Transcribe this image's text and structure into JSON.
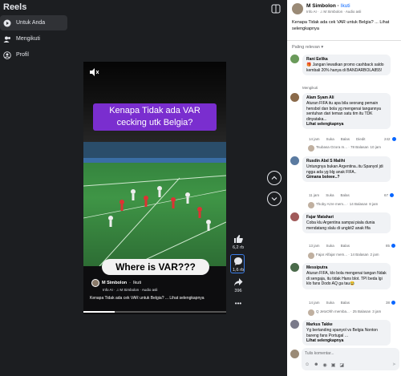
{
  "sidebar": {
    "title": "Reels",
    "items": [
      {
        "label": "Untuk Anda",
        "icon": "play-icon"
      },
      {
        "label": "Mengikuti",
        "icon": "people-icon"
      },
      {
        "label": "Profil",
        "icon": "profile-icon"
      }
    ]
  },
  "video": {
    "caption_top": "Kenapa Tidak ada VAR cecking utk Belgia?",
    "caption_bottom": "Where is VAR???",
    "author": "M Simbolon",
    "follow": "Ikuti",
    "info": "Info AI · ♫ M Simbolon · Audio asli",
    "description": "Kenapa Tidak ada cek VAR untuk Belgia? ... Lihat selengkapnya",
    "progress_fraction": 0.22
  },
  "actions": {
    "likes": "6,2 rb",
    "comments": "1,6 rb",
    "shares": "396",
    "more": "•••"
  },
  "post": {
    "author": "M Simbolon",
    "follow": "Ikuti",
    "sub": "Info AI · ♫ M Simbolon · Audio asli",
    "text": "Kenapa Tidak ada cek VAR untuk Belgia? ... Lihat selengkapnya"
  },
  "comments_sort": "Paling relevan ▾",
  "comments": [
    {
      "name": "Rani Eelika",
      "text": "🎁 Jangan lewatkan promo cashback saldo kembali 20% hanya di BANDARBOLA855!",
      "meta": [
        "Mengikuti"
      ],
      "count": "",
      "replies": ""
    },
    {
      "name": "Alam Syam Ali",
      "text": "Aturan FIFA itu apa bila seorang pemain hensbol dan bola yg mengenai tangannya sentuhan dari teman satu tim itu TDK dinyataka...",
      "more": "Lihat selengkapnya",
      "meta": [
        "14 jam",
        "Suka",
        "Balas",
        "Diedit"
      ],
      "count": "242",
      "replies": "Tsubasa Ozora m... · 78 Balasan",
      "reply_time": "10 jam"
    },
    {
      "name": "Rusdin Abd S Malihi",
      "text": "Untungnya bukan Argentina..itu Spanyol jdi ngga ada yg blg anak FIFA..",
      "more": "Gimana boleee..?",
      "meta": [
        "11 jam",
        "Suka",
        "Balas"
      ],
      "count": "67",
      "replies": "Thoby Azre mem... · 14 Balasan",
      "reply_time": "8 jam"
    },
    {
      "name": "Fajar Matahari",
      "text": "Coba klu Argentina sampai piala dunia mendatang slalu di ungkit2 anak fifa",
      "more": "",
      "meta": [
        "13 jam",
        "Suka",
        "Balas"
      ],
      "count": "85",
      "replies": "Fajar Alfajar mem... · 14 Balasan",
      "reply_time": "2 jam"
    },
    {
      "name": "Messiputra",
      "text": "Aturan FIFA, klo bola mengenai tangan Ndak di sengaja, itu tidak Hans blot. TPI beda lgi klo fans Dodo AQ ga tau😂",
      "more": "",
      "meta": [
        "14 jam",
        "Suka",
        "Balas"
      ],
      "count": "38",
      "replies": "Q JetoOhh memba... · 25 Balasan",
      "reply_time": "3 jam"
    },
    {
      "name": "Markus Takke",
      "text": "Yg bertanding spanyol vs Belgia Nonton bareng fans Portugal ...",
      "more": "Lihat selengkapnya",
      "meta": [],
      "count": "",
      "replies": ""
    }
  ],
  "input": {
    "placeholder": "Tulis komentar...",
    "icons": [
      "sticker-icon",
      "emoji-icon",
      "camera-icon",
      "gif-icon",
      "sticker2-icon"
    ]
  }
}
